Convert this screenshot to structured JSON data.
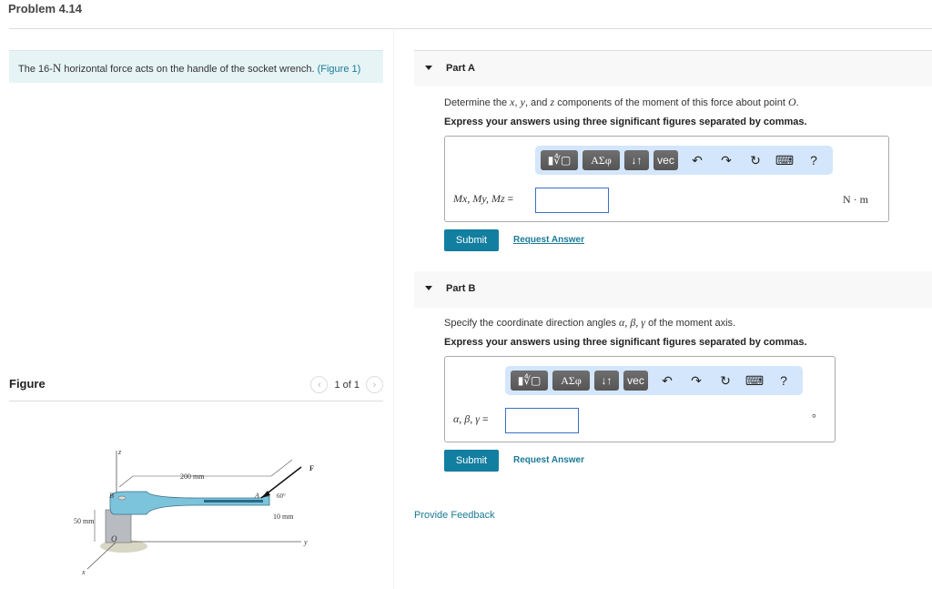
{
  "header": {
    "title": "Problem 4.14"
  },
  "intro": {
    "text_before": "The 16-",
    "unit": "N",
    "text_after": " horizontal force acts on the handle of the socket wrench. ",
    "figure_link": "(Figure 1)"
  },
  "figure": {
    "title": "Figure",
    "pager_text": "1 of 1",
    "prev_icon": "chevron-left-icon",
    "next_icon": "chevron-right-icon",
    "labels": {
      "z": "z",
      "x": "x",
      "y": "y",
      "B": "B",
      "O": "O",
      "A": "A",
      "F": "F",
      "dim_200": "200 mm",
      "dim_50": "50 mm",
      "dim_10": "10 mm",
      "angle": "60°"
    }
  },
  "parts": [
    {
      "label": "Part A",
      "question_before": "Determine the ",
      "vars": [
        "x",
        "y",
        "z"
      ],
      "question_mid1": ", ",
      "question_mid2": ", and ",
      "question_after": " components of the moment of this force about point ",
      "point": "O",
      "question_end": ".",
      "instruction": "Express your answers using three significant figures separated by commas.",
      "equation_label": "Mx, My, Mz",
      "equals": "=",
      "input_value": "",
      "unit": "N · m",
      "submit_label": "Submit",
      "request_label": "Request Answer"
    },
    {
      "label": "Part B",
      "question_before": "Specify the coordinate direction angles ",
      "greek": "α, β, γ",
      "question_after": " of the moment axis.",
      "instruction": "Express your answers using three significant figures separated by commas.",
      "equation_label": "α, β, γ",
      "equals": "=",
      "input_value": "",
      "unit": "°",
      "submit_label": "Submit",
      "request_label": "Request Answer"
    }
  ],
  "toolbar": {
    "buttons": [
      {
        "name": "templates-button",
        "label": "▮∜▢"
      },
      {
        "name": "greek-symbols-button",
        "label": "ΑΣφ"
      },
      {
        "name": "subsup-button",
        "label": "↓↑"
      },
      {
        "name": "vector-button",
        "label": "vec"
      }
    ],
    "icons": [
      {
        "name": "undo-icon",
        "glyph": "↶"
      },
      {
        "name": "redo-icon",
        "glyph": "↷"
      },
      {
        "name": "reset-icon",
        "glyph": "↻"
      },
      {
        "name": "keyboard-icon",
        "glyph": "⌨"
      },
      {
        "name": "help-icon",
        "glyph": "?"
      }
    ]
  },
  "footer": {
    "feedback_label": "Provide Feedback"
  }
}
